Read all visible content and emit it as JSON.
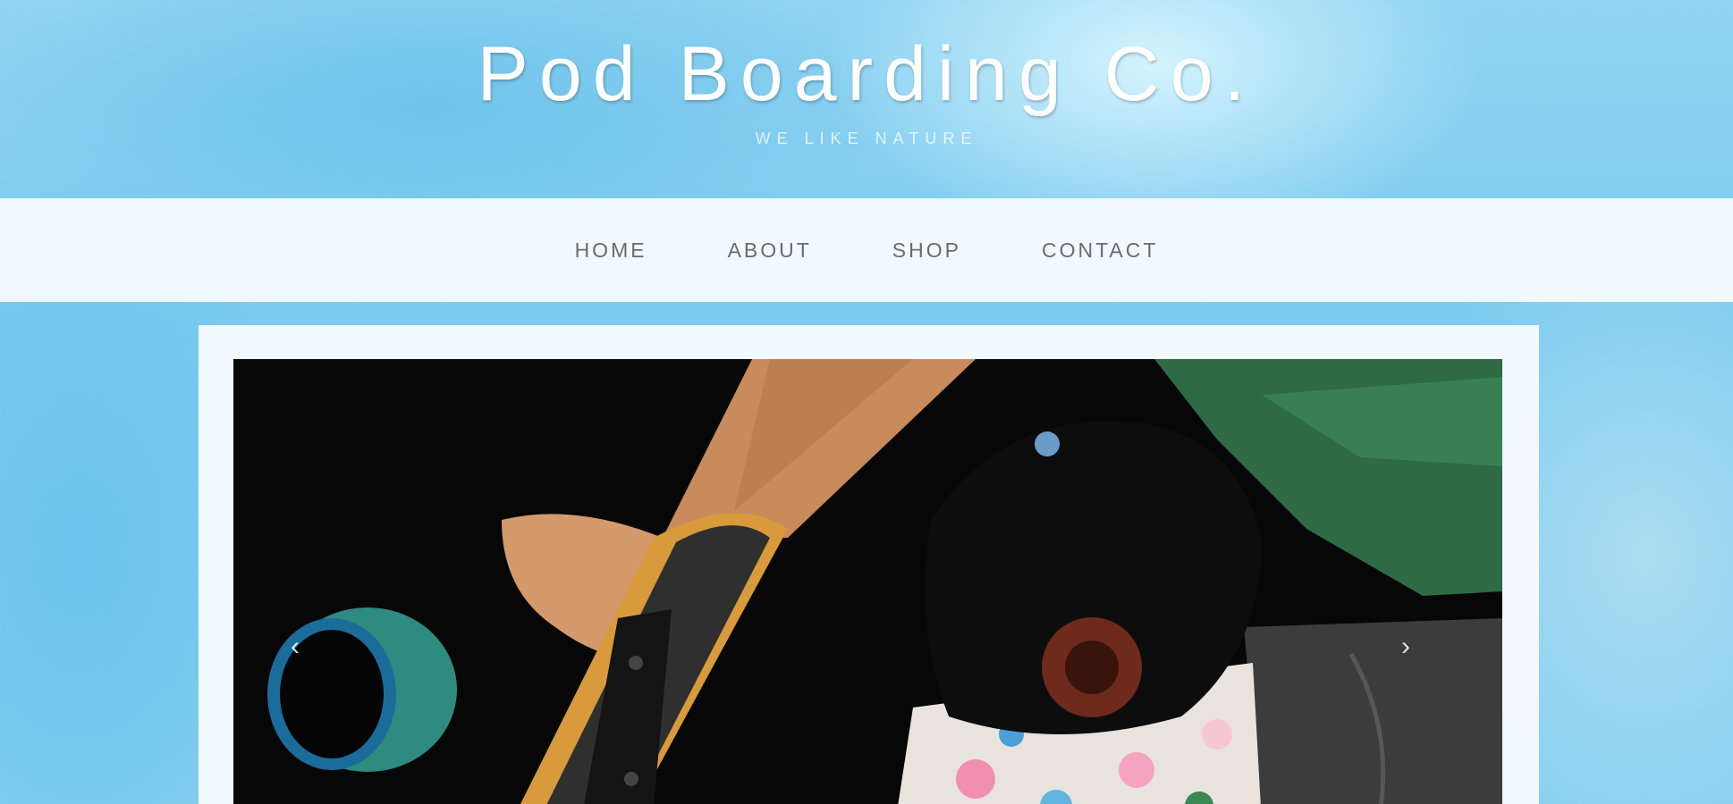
{
  "site": {
    "title": "Pod Boarding Co.",
    "tagline": "WE LIKE NATURE"
  },
  "nav": {
    "items": [
      {
        "label": "HOME"
      },
      {
        "label": "ABOUT"
      },
      {
        "label": "SHOP"
      },
      {
        "label": "CONTACT"
      }
    ]
  },
  "slider": {
    "prev_icon": "chevron-left",
    "next_icon": "chevron-right",
    "prev_glyph": "‹",
    "next_glyph": "›",
    "image_subject": "person holding longboard skateboard with teal wheel and black cap"
  },
  "colors": {
    "background_accent": "#86cff0",
    "nav_text": "#6b6b6b",
    "title_text": "#ffffff"
  }
}
